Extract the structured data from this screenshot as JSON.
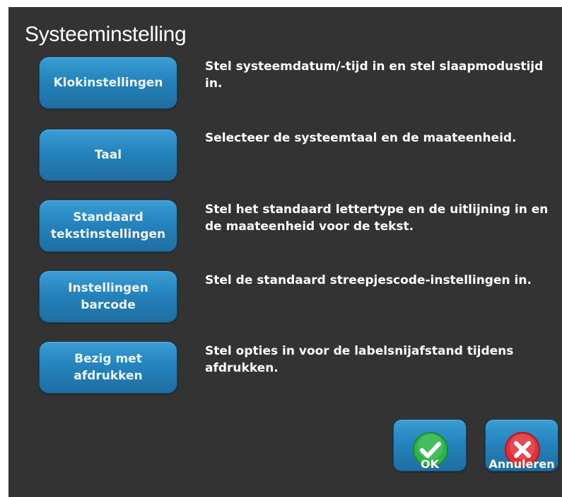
{
  "window": {
    "title": "Systeeminstelling"
  },
  "settings": [
    {
      "label": [
        "Klokinstellingen"
      ],
      "description": "Stel systeemdatum/-tijd in en stel slaapmodustijd in."
    },
    {
      "label": [
        "Taal"
      ],
      "description": "Selecteer de systeemtaal en de maateenheid."
    },
    {
      "label": [
        "Standaard",
        "tekstinstellingen"
      ],
      "description": "Stel het standaard lettertype en de uitlijning in en de maateenheid voor de tekst."
    },
    {
      "label": [
        "Instellingen barcode"
      ],
      "description": "Stel de standaard streepjescode-instellingen in."
    },
    {
      "label": [
        "Bezig met",
        "afdrukken"
      ],
      "description": "Stel opties in voor de labelsnijafstand tijdens afdrukken."
    }
  ],
  "actions": {
    "ok": {
      "label": "OK",
      "icon": "check-icon",
      "color": "#2db34a"
    },
    "cancel": {
      "label": "Annuleren",
      "icon": "close-icon",
      "color": "#e0313a"
    }
  },
  "colors": {
    "background": "#333333",
    "button": "#2583bd",
    "text": "#ffffff"
  }
}
